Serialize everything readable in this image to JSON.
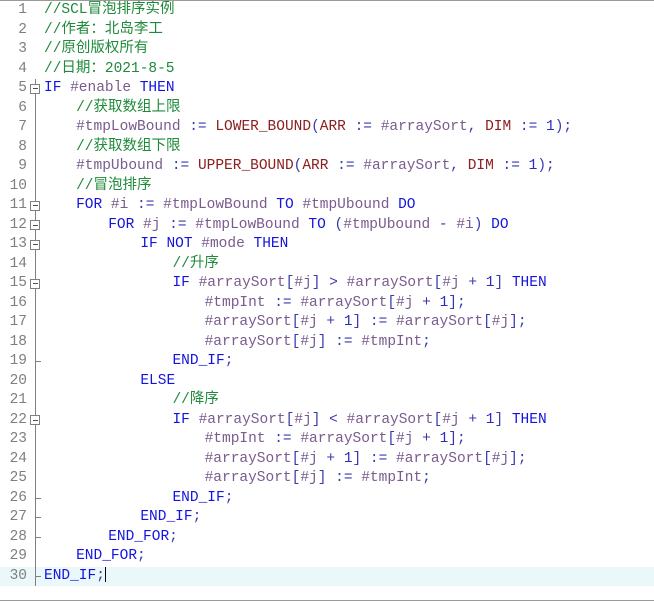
{
  "editor": {
    "language": "SCL",
    "current_line": 30,
    "total_lines": 30,
    "colors": {
      "background": "#ffffff",
      "current_line_highlight": "#eaf8fa",
      "gutter_number": "#7f7f7f",
      "comment": "#1f8b3a",
      "keyword": "#1414e0",
      "variable": "#7a5b8e",
      "function": "#8b2020",
      "operator": "#3a3ab0",
      "number": "#2b2bc0",
      "fold_marker": "#808080"
    }
  },
  "lines": [
    {
      "num": "1",
      "fold": "none",
      "indent": 0,
      "tokens": [
        {
          "t": "//SCL冒泡排序实例",
          "c": "cm"
        }
      ]
    },
    {
      "num": "2",
      "fold": "none",
      "indent": 0,
      "tokens": [
        {
          "t": "//作者：北岛李工",
          "c": "cm"
        }
      ]
    },
    {
      "num": "3",
      "fold": "none",
      "indent": 0,
      "tokens": [
        {
          "t": "//原创版权所有",
          "c": "cm"
        }
      ]
    },
    {
      "num": "4",
      "fold": "none",
      "indent": 0,
      "tokens": [
        {
          "t": "//日期：2021-8-5",
          "c": "cm"
        }
      ]
    },
    {
      "num": "5",
      "fold": "box",
      "indent": 0,
      "tokens": [
        {
          "t": "IF",
          "c": "kw"
        },
        {
          "t": " ",
          "c": "pl"
        },
        {
          "t": "#enable",
          "c": "var"
        },
        {
          "t": " ",
          "c": "pl"
        },
        {
          "t": "THEN",
          "c": "kw"
        }
      ]
    },
    {
      "num": "6",
      "fold": "line",
      "indent": 4,
      "tokens": [
        {
          "t": "//获取数组上限",
          "c": "cm"
        }
      ]
    },
    {
      "num": "7",
      "fold": "line",
      "indent": 4,
      "tokens": [
        {
          "t": "#tmpLowBound",
          "c": "var"
        },
        {
          "t": " := ",
          "c": "op"
        },
        {
          "t": "LOWER_BOUND",
          "c": "fn"
        },
        {
          "t": "(",
          "c": "pl"
        },
        {
          "t": "ARR",
          "c": "pm"
        },
        {
          "t": " := ",
          "c": "op"
        },
        {
          "t": "#arraySort",
          "c": "var"
        },
        {
          "t": ", ",
          "c": "pl"
        },
        {
          "t": "DIM",
          "c": "pm"
        },
        {
          "t": " := ",
          "c": "op"
        },
        {
          "t": "1",
          "c": "num"
        },
        {
          "t": ");",
          "c": "pl"
        }
      ]
    },
    {
      "num": "8",
      "fold": "line",
      "indent": 4,
      "tokens": [
        {
          "t": "//获取数组下限",
          "c": "cm"
        }
      ]
    },
    {
      "num": "9",
      "fold": "line",
      "indent": 4,
      "tokens": [
        {
          "t": "#tmpUbound",
          "c": "var"
        },
        {
          "t": " := ",
          "c": "op"
        },
        {
          "t": "UPPER_BOUND",
          "c": "fn"
        },
        {
          "t": "(",
          "c": "pl"
        },
        {
          "t": "ARR",
          "c": "pm"
        },
        {
          "t": " := ",
          "c": "op"
        },
        {
          "t": "#arraySort",
          "c": "var"
        },
        {
          "t": ", ",
          "c": "pl"
        },
        {
          "t": "DIM",
          "c": "pm"
        },
        {
          "t": " := ",
          "c": "op"
        },
        {
          "t": "1",
          "c": "num"
        },
        {
          "t": ");",
          "c": "pl"
        }
      ]
    },
    {
      "num": "10",
      "fold": "line",
      "indent": 4,
      "tokens": [
        {
          "t": "//冒泡排序",
          "c": "cm"
        }
      ]
    },
    {
      "num": "11",
      "fold": "box",
      "indent": 4,
      "tokens": [
        {
          "t": "FOR",
          "c": "kw"
        },
        {
          "t": " ",
          "c": "pl"
        },
        {
          "t": "#i",
          "c": "var"
        },
        {
          "t": " := ",
          "c": "op"
        },
        {
          "t": "#tmpLowBound",
          "c": "var"
        },
        {
          "t": " ",
          "c": "pl"
        },
        {
          "t": "TO",
          "c": "kw"
        },
        {
          "t": " ",
          "c": "pl"
        },
        {
          "t": "#tmpUbound",
          "c": "var"
        },
        {
          "t": " ",
          "c": "pl"
        },
        {
          "t": "DO",
          "c": "kw"
        }
      ]
    },
    {
      "num": "12",
      "fold": "box",
      "indent": 8,
      "tokens": [
        {
          "t": "FOR",
          "c": "kw"
        },
        {
          "t": " ",
          "c": "pl"
        },
        {
          "t": "#j",
          "c": "var"
        },
        {
          "t": " := ",
          "c": "op"
        },
        {
          "t": "#tmpLowBound",
          "c": "var"
        },
        {
          "t": " ",
          "c": "pl"
        },
        {
          "t": "TO",
          "c": "kw"
        },
        {
          "t": " (",
          "c": "pl"
        },
        {
          "t": "#tmpUbound",
          "c": "var"
        },
        {
          "t": " - ",
          "c": "op"
        },
        {
          "t": "#i",
          "c": "var"
        },
        {
          "t": ") ",
          "c": "pl"
        },
        {
          "t": "DO",
          "c": "kw"
        }
      ]
    },
    {
      "num": "13",
      "fold": "box",
      "indent": 12,
      "tokens": [
        {
          "t": "IF",
          "c": "kw"
        },
        {
          "t": " ",
          "c": "pl"
        },
        {
          "t": "NOT",
          "c": "kw"
        },
        {
          "t": " ",
          "c": "pl"
        },
        {
          "t": "#mode",
          "c": "var"
        },
        {
          "t": " ",
          "c": "pl"
        },
        {
          "t": "THEN",
          "c": "kw"
        }
      ]
    },
    {
      "num": "14",
      "fold": "line",
      "indent": 16,
      "tokens": [
        {
          "t": "//升序",
          "c": "cm"
        }
      ]
    },
    {
      "num": "15",
      "fold": "box",
      "indent": 16,
      "tokens": [
        {
          "t": "IF",
          "c": "kw"
        },
        {
          "t": " ",
          "c": "pl"
        },
        {
          "t": "#arraySort",
          "c": "var"
        },
        {
          "t": "[",
          "c": "pl"
        },
        {
          "t": "#j",
          "c": "var"
        },
        {
          "t": "]",
          "c": "pl"
        },
        {
          "t": " > ",
          "c": "op"
        },
        {
          "t": "#arraySort",
          "c": "var"
        },
        {
          "t": "[",
          "c": "pl"
        },
        {
          "t": "#j",
          "c": "var"
        },
        {
          "t": " + ",
          "c": "op"
        },
        {
          "t": "1",
          "c": "num"
        },
        {
          "t": "] ",
          "c": "pl"
        },
        {
          "t": "THEN",
          "c": "kw"
        }
      ]
    },
    {
      "num": "16",
      "fold": "line",
      "indent": 20,
      "tokens": [
        {
          "t": "#tmpInt",
          "c": "var"
        },
        {
          "t": " := ",
          "c": "op"
        },
        {
          "t": "#arraySort",
          "c": "var"
        },
        {
          "t": "[",
          "c": "pl"
        },
        {
          "t": "#j",
          "c": "var"
        },
        {
          "t": " + ",
          "c": "op"
        },
        {
          "t": "1",
          "c": "num"
        },
        {
          "t": "];",
          "c": "pl"
        }
      ]
    },
    {
      "num": "17",
      "fold": "line",
      "indent": 20,
      "tokens": [
        {
          "t": "#arraySort",
          "c": "var"
        },
        {
          "t": "[",
          "c": "pl"
        },
        {
          "t": "#j",
          "c": "var"
        },
        {
          "t": " + ",
          "c": "op"
        },
        {
          "t": "1",
          "c": "num"
        },
        {
          "t": "]",
          "c": "pl"
        },
        {
          "t": " := ",
          "c": "op"
        },
        {
          "t": "#arraySort",
          "c": "var"
        },
        {
          "t": "[",
          "c": "pl"
        },
        {
          "t": "#j",
          "c": "var"
        },
        {
          "t": "];",
          "c": "pl"
        }
      ]
    },
    {
      "num": "18",
      "fold": "line",
      "indent": 20,
      "tokens": [
        {
          "t": "#arraySort",
          "c": "var"
        },
        {
          "t": "[",
          "c": "pl"
        },
        {
          "t": "#j",
          "c": "var"
        },
        {
          "t": "]",
          "c": "pl"
        },
        {
          "t": " := ",
          "c": "op"
        },
        {
          "t": "#tmpInt",
          "c": "var"
        },
        {
          "t": ";",
          "c": "pl"
        }
      ]
    },
    {
      "num": "19",
      "fold": "foot",
      "indent": 16,
      "tokens": [
        {
          "t": "END_IF",
          "c": "kw"
        },
        {
          "t": ";",
          "c": "pl"
        }
      ]
    },
    {
      "num": "20",
      "fold": "line",
      "indent": 12,
      "tokens": [
        {
          "t": "ELSE",
          "c": "kw"
        }
      ]
    },
    {
      "num": "21",
      "fold": "line",
      "indent": 16,
      "tokens": [
        {
          "t": "//降序",
          "c": "cm"
        }
      ]
    },
    {
      "num": "22",
      "fold": "box",
      "indent": 16,
      "tokens": [
        {
          "t": "IF",
          "c": "kw"
        },
        {
          "t": " ",
          "c": "pl"
        },
        {
          "t": "#arraySort",
          "c": "var"
        },
        {
          "t": "[",
          "c": "pl"
        },
        {
          "t": "#j",
          "c": "var"
        },
        {
          "t": "]",
          "c": "pl"
        },
        {
          "t": " < ",
          "c": "op"
        },
        {
          "t": "#arraySort",
          "c": "var"
        },
        {
          "t": "[",
          "c": "pl"
        },
        {
          "t": "#j",
          "c": "var"
        },
        {
          "t": " + ",
          "c": "op"
        },
        {
          "t": "1",
          "c": "num"
        },
        {
          "t": "] ",
          "c": "pl"
        },
        {
          "t": "THEN",
          "c": "kw"
        }
      ]
    },
    {
      "num": "23",
      "fold": "line",
      "indent": 20,
      "tokens": [
        {
          "t": "#tmpInt",
          "c": "var"
        },
        {
          "t": " := ",
          "c": "op"
        },
        {
          "t": "#arraySort",
          "c": "var"
        },
        {
          "t": "[",
          "c": "pl"
        },
        {
          "t": "#j",
          "c": "var"
        },
        {
          "t": " + ",
          "c": "op"
        },
        {
          "t": "1",
          "c": "num"
        },
        {
          "t": "];",
          "c": "pl"
        }
      ]
    },
    {
      "num": "24",
      "fold": "line",
      "indent": 20,
      "tokens": [
        {
          "t": "#arraySort",
          "c": "var"
        },
        {
          "t": "[",
          "c": "pl"
        },
        {
          "t": "#j",
          "c": "var"
        },
        {
          "t": " + ",
          "c": "op"
        },
        {
          "t": "1",
          "c": "num"
        },
        {
          "t": "]",
          "c": "pl"
        },
        {
          "t": " := ",
          "c": "op"
        },
        {
          "t": "#arraySort",
          "c": "var"
        },
        {
          "t": "[",
          "c": "pl"
        },
        {
          "t": "#j",
          "c": "var"
        },
        {
          "t": "];",
          "c": "pl"
        }
      ]
    },
    {
      "num": "25",
      "fold": "line",
      "indent": 20,
      "tokens": [
        {
          "t": "#arraySort",
          "c": "var"
        },
        {
          "t": "[",
          "c": "pl"
        },
        {
          "t": "#j",
          "c": "var"
        },
        {
          "t": "]",
          "c": "pl"
        },
        {
          "t": " := ",
          "c": "op"
        },
        {
          "t": "#tmpInt",
          "c": "var"
        },
        {
          "t": ";",
          "c": "pl"
        }
      ]
    },
    {
      "num": "26",
      "fold": "foot",
      "indent": 16,
      "tokens": [
        {
          "t": "END_IF",
          "c": "kw"
        },
        {
          "t": ";",
          "c": "pl"
        }
      ]
    },
    {
      "num": "27",
      "fold": "foot",
      "indent": 12,
      "tokens": [
        {
          "t": "END_IF",
          "c": "kw"
        },
        {
          "t": ";",
          "c": "pl"
        }
      ]
    },
    {
      "num": "28",
      "fold": "foot",
      "indent": 8,
      "tokens": [
        {
          "t": "END_FOR",
          "c": "kw"
        },
        {
          "t": ";",
          "c": "pl"
        }
      ]
    },
    {
      "num": "29",
      "fold": "line",
      "indent": 4,
      "tokens": [
        {
          "t": "END_FOR",
          "c": "kw"
        },
        {
          "t": ";",
          "c": "pl"
        }
      ]
    },
    {
      "num": "30",
      "fold": "foot",
      "indent": 0,
      "current": true,
      "caret": true,
      "tokens": [
        {
          "t": "END_IF",
          "c": "kw"
        },
        {
          "t": ";",
          "c": "pl"
        }
      ]
    }
  ]
}
